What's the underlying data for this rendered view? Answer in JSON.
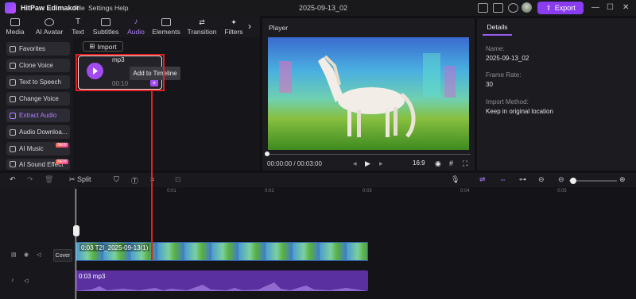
{
  "app": {
    "name": "HitPaw Edimakor",
    "menu": [
      "File",
      "Settings",
      "Help"
    ],
    "doc_title": "2025-09-13_02",
    "export_label": "Export"
  },
  "tabs": [
    {
      "label": "Media"
    },
    {
      "label": "AI Avatar"
    },
    {
      "label": "Text"
    },
    {
      "label": "Subtitles"
    },
    {
      "label": "Audio",
      "active": true
    },
    {
      "label": "Elements"
    },
    {
      "label": "Transition"
    },
    {
      "label": "Filters"
    }
  ],
  "sidebar": {
    "items": [
      {
        "label": "Favorites"
      },
      {
        "label": "Clone Voice"
      },
      {
        "label": "Text to Speech"
      },
      {
        "label": "Change Voice"
      },
      {
        "label": "Extract Audio",
        "active": true
      },
      {
        "label": "Audio Downloa..."
      },
      {
        "label": "AI Music",
        "badge": "NEW"
      },
      {
        "label": "AI Sound Effect",
        "badge": "NEW"
      }
    ]
  },
  "media": {
    "import_label": "Import",
    "card": {
      "name": "mp3",
      "duration": "00:10",
      "add_symbol": "+"
    },
    "tooltip": "Add to Timeline"
  },
  "player": {
    "title": "Player",
    "timecode": "00:00:00 / 00:03:00",
    "aspect": "16:9",
    "progress": 0
  },
  "details": {
    "tab": "Details",
    "fields": [
      {
        "label": "Name:",
        "value": "2025-09-13_02"
      },
      {
        "label": "Frame Rate:",
        "value": "30"
      },
      {
        "label": "Import Method:",
        "value": "Keep in original location"
      }
    ]
  },
  "timeline": {
    "split_label": "Split",
    "ruler": [
      "0:01",
      "0:02",
      "0:03",
      "0:04",
      "0:05"
    ],
    "cover_label": "Cover",
    "video_clip_label": "0:03 T2I_2025-09-13(1)",
    "audio_clip_label": "0:03 mp3"
  },
  "colors": {
    "accent": "#8a3cf0",
    "annotation": "#e02020",
    "audio_clip": "#5a2fa0"
  }
}
